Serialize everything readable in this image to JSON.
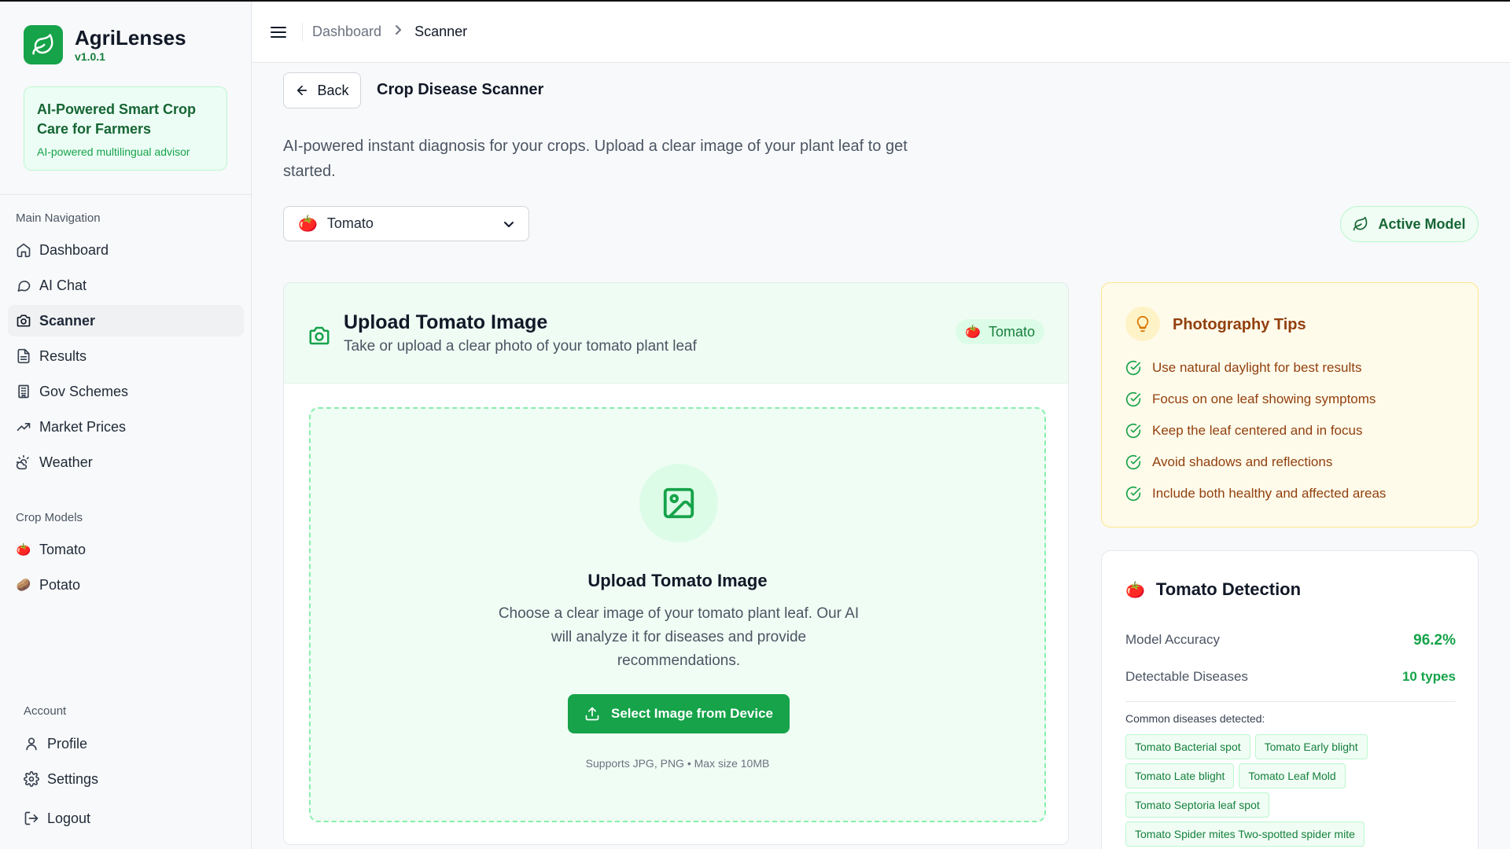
{
  "app": {
    "name": "AgriLenses",
    "version": "v1.0.1",
    "promo_title": "AI-Powered Smart Crop Care for Farmers",
    "promo_sub": "AI-powered multilingual advisor",
    "accent_color": "#16a34a"
  },
  "sidebar": {
    "main_label": "Main Navigation",
    "items": [
      {
        "label": "Dashboard",
        "icon": "home-icon"
      },
      {
        "label": "AI Chat",
        "icon": "chat-icon"
      },
      {
        "label": "Scanner",
        "icon": "camera-icon",
        "active": true
      },
      {
        "label": "Results",
        "icon": "document-icon"
      },
      {
        "label": "Gov Schemes",
        "icon": "building-icon"
      },
      {
        "label": "Market Prices",
        "icon": "trend-icon"
      },
      {
        "label": "Weather",
        "icon": "weather-icon"
      }
    ],
    "crop_label": "Crop Models",
    "crops": [
      {
        "label": "Tomato",
        "icon": "🍅"
      },
      {
        "label": "Potato",
        "icon": "🥔"
      }
    ],
    "account_label": "Account",
    "account_items": [
      {
        "label": "Profile",
        "icon": "user-icon"
      },
      {
        "label": "Settings",
        "icon": "gear-icon"
      },
      {
        "label": "Logout",
        "icon": "logout-icon"
      }
    ]
  },
  "breadcrumb": {
    "items": [
      "Dashboard",
      "Scanner"
    ]
  },
  "header": {
    "back_label": "Back",
    "title": "Crop Disease Scanner",
    "description": "AI-powered instant diagnosis for your crops. Upload a clear image of your plant leaf to get started.",
    "crop_select_value": "Tomato",
    "crop_select_icon": "🍅",
    "active_model_label": "Active Model"
  },
  "upload": {
    "title": "Upload Tomato Image",
    "subtitle": "Take or upload a clear photo of your tomato plant leaf",
    "badge_label": "Tomato",
    "badge_icon": "🍅",
    "drop_title": "Upload Tomato Image",
    "drop_desc": "Choose a clear image of your tomato plant leaf. Our AI will analyze it for diseases and provide recommendations.",
    "button_label": "Select Image from Device",
    "note": "Supports JPG, PNG • Max size 10MB"
  },
  "tips": {
    "title": "Photography Tips",
    "items": [
      "Use natural daylight for best results",
      "Focus on one leaf showing symptoms",
      "Keep the leaf centered and in focus",
      "Avoid shadows and reflections",
      "Include both healthy and affected areas"
    ]
  },
  "detection": {
    "title": "Tomato Detection",
    "icon": "🍅",
    "accuracy_label": "Model Accuracy",
    "accuracy_value": "96.2%",
    "diseases_label": "Detectable Diseases",
    "diseases_value": "10 types",
    "common_label": "Common diseases detected:",
    "chips": [
      "Tomato Bacterial spot",
      "Tomato Early blight",
      "Tomato Late blight",
      "Tomato Leaf Mold",
      "Tomato Septoria leaf spot",
      "Tomato Spider mites Two-spotted spider mite"
    ]
  }
}
